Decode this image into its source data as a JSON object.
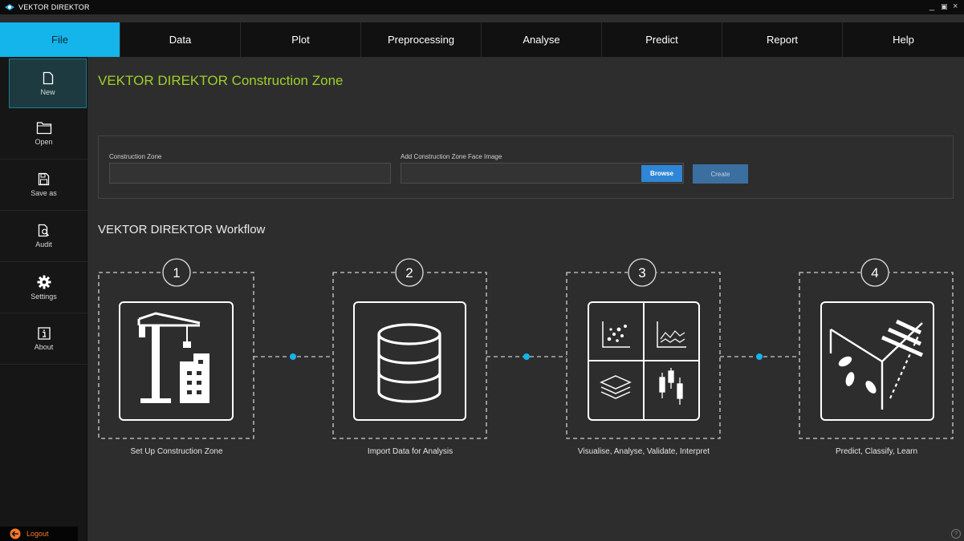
{
  "window": {
    "title": "VEKTOR DIREKTOR",
    "minimize_glyph": "_",
    "restore_glyph": "▣",
    "close_glyph": "×"
  },
  "menu": {
    "items": [
      {
        "label": "File",
        "active": true
      },
      {
        "label": "Data"
      },
      {
        "label": "Plot"
      },
      {
        "label": "Preprocessing"
      },
      {
        "label": "Analyse"
      },
      {
        "label": "Predict"
      },
      {
        "label": "Report"
      },
      {
        "label": "Help"
      }
    ]
  },
  "sidebar": {
    "items": [
      {
        "label": "New",
        "icon": "new-file-icon",
        "active": true
      },
      {
        "label": "Open",
        "icon": "open-folder-icon"
      },
      {
        "label": "Save as",
        "icon": "save-as-icon"
      },
      {
        "label": "Audit",
        "icon": "audit-icon"
      },
      {
        "label": "Settings",
        "icon": "gear-icon"
      },
      {
        "label": "About",
        "icon": "info-icon"
      }
    ],
    "logout_label": "Logout"
  },
  "construction": {
    "heading": "VEKTOR DIREKTOR Construction Zone",
    "zone_label": "Construction Zone",
    "zone_value": "",
    "image_label": "Add Construction Zone Face Image",
    "image_value": "",
    "browse_label": "Browse",
    "create_label": "Create"
  },
  "workflow": {
    "heading": "VEKTOR DIREKTOR Workflow",
    "steps": [
      {
        "number": "1",
        "caption": "Set Up Construction Zone",
        "icon": "construction-crane-icon"
      },
      {
        "number": "2",
        "caption": "Import Data for Analysis",
        "icon": "database-icon"
      },
      {
        "number": "3",
        "caption": "Visualise, Analyse, Validate, Interpret",
        "icon": "chart-grid-icon"
      },
      {
        "number": "4",
        "caption": "Predict, Classify, Learn",
        "icon": "model-cube-icon"
      }
    ]
  },
  "colors": {
    "accent": "#14b5ea",
    "heading_green": "#9fcf2b",
    "connector_dot": "#14b5ea",
    "logout": "#ff7a2a"
  }
}
